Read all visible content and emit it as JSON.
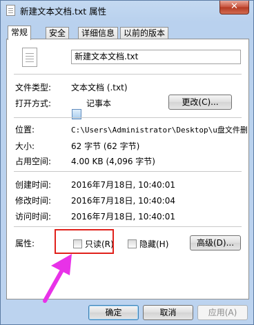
{
  "window": {
    "title": "新建文本文档.txt 属性",
    "close_glyph": "✕"
  },
  "tabs": [
    {
      "label": "常规",
      "active": true
    },
    {
      "label": "安全",
      "active": false
    },
    {
      "label": "详细信息",
      "active": false
    },
    {
      "label": "以前的版本",
      "active": false
    }
  ],
  "general": {
    "file_name": "新建文本文档.txt",
    "file_type_label": "文件类型:",
    "file_type_value": "文本文档 (.txt)",
    "opens_with_label": "打开方式:",
    "opens_with_value": "记事本",
    "change_button": "更改(C)...",
    "location_label": "位置:",
    "location_value": "C:\\Users\\Administrator\\Desktop\\u盘文件删不",
    "size_label": "大小:",
    "size_value": "62 字节 (62 字节)",
    "size_on_disk_label": "占用空间:",
    "size_on_disk_value": "4.00 KB (4,096 字节)",
    "created_label": "创建时间:",
    "created_value": "2016年7月18日, 10:40:01",
    "modified_label": "修改时间:",
    "modified_value": "2016年7月18日, 10:40:04",
    "accessed_label": "访问时间:",
    "accessed_value": "2016年7月18日, 10:40:01",
    "attributes_label": "属性:",
    "readonly_label": "只读(R)",
    "readonly_checked": false,
    "hidden_label": "隐藏(H)",
    "hidden_checked": false,
    "advanced_button": "高级(D)..."
  },
  "footer": {
    "ok_button": "确定",
    "cancel_button": "取消",
    "apply_button": "应用(A)"
  },
  "annotation": {
    "highlight_color": "#e0201a",
    "arrow_color": "#e832e8"
  },
  "icons": [
    "text-file-icon",
    "notepad-icon",
    "close-icon"
  ]
}
